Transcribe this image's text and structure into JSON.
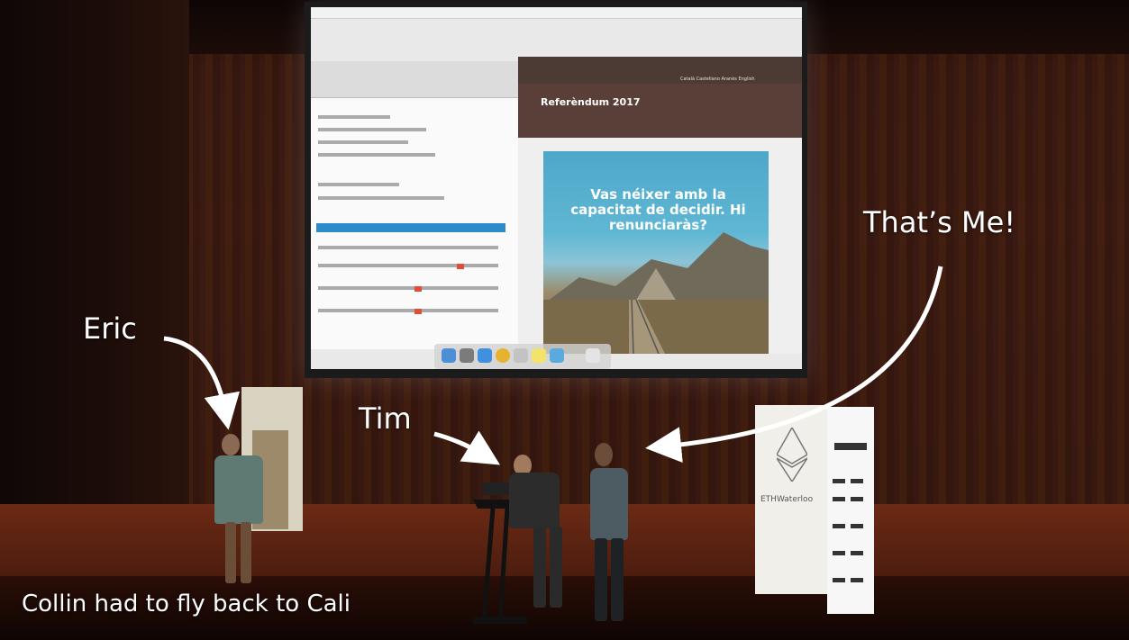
{
  "labels": {
    "eric": "Eric",
    "tim": "Tim",
    "me": "That’s Me!",
    "collin": "Collin had to fly back to Cali"
  },
  "screen": {
    "page_title": "Referèndum 2017",
    "slogan": "Vas néixer amb la capacitat de decidir. Hi renunciaràs?",
    "languages": "Català   Castellano   Aranès   English"
  },
  "banners": {
    "eth_sponsor": "ETHWaterloo"
  },
  "colors": {
    "label_text": "#ffffff",
    "arrow": "#ffffff",
    "stage_floor": "#5a2312",
    "screen_brand": "#5a3f38"
  }
}
